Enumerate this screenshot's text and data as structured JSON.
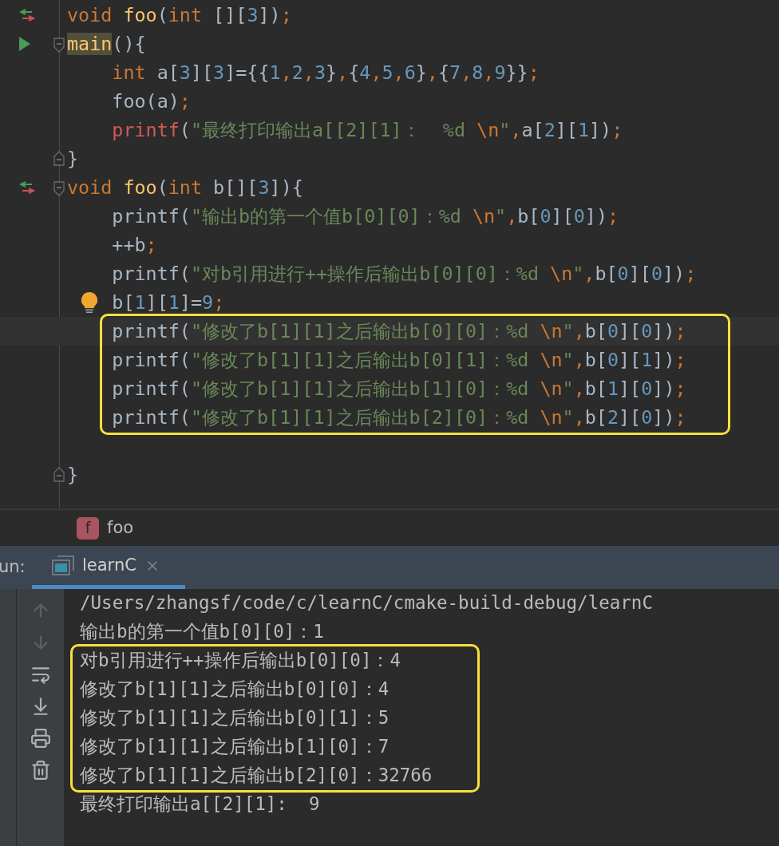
{
  "editor": {
    "lines": [
      {
        "marker": {
          "kind": "override"
        },
        "current": false,
        "boxed": false,
        "tokens": [
          {
            "kind": "kw",
            "text": "void"
          },
          {
            "kind": "fn",
            "text": " foo"
          },
          {
            "kind": "plain",
            "text": "("
          },
          {
            "kind": "kw",
            "text": "int"
          },
          {
            "kind": "plain",
            "text": " []["
          },
          {
            "kind": "num",
            "text": "3"
          },
          {
            "kind": "plain",
            "text": "])"
          },
          {
            "kind": "punct",
            "text": ";"
          }
        ]
      },
      {
        "marker": {
          "kind": "run"
        },
        "fold": {
          "kind": "start"
        },
        "current": false,
        "boxed": false,
        "tokens": [
          {
            "kind": "fn_hl",
            "text": "main"
          },
          {
            "kind": "plain",
            "text": "(){"
          }
        ]
      },
      {
        "current": false,
        "boxed": false,
        "tokens": [
          {
            "kind": "kw",
            "text": "    int"
          },
          {
            "kind": "plain",
            "text": " a["
          },
          {
            "kind": "num",
            "text": "3"
          },
          {
            "kind": "plain",
            "text": "]["
          },
          {
            "kind": "num",
            "text": "3"
          },
          {
            "kind": "plain",
            "text": "]={{"
          },
          {
            "kind": "num",
            "text": "1"
          },
          {
            "kind": "punct",
            "text": ","
          },
          {
            "kind": "num",
            "text": "2"
          },
          {
            "kind": "punct",
            "text": ","
          },
          {
            "kind": "num",
            "text": "3"
          },
          {
            "kind": "plain",
            "text": "}"
          },
          {
            "kind": "punct",
            "text": ","
          },
          {
            "kind": "plain",
            "text": "{"
          },
          {
            "kind": "num",
            "text": "4"
          },
          {
            "kind": "punct",
            "text": ","
          },
          {
            "kind": "num",
            "text": "5"
          },
          {
            "kind": "punct",
            "text": ","
          },
          {
            "kind": "num",
            "text": "6"
          },
          {
            "kind": "plain",
            "text": "}"
          },
          {
            "kind": "punct",
            "text": ","
          },
          {
            "kind": "plain",
            "text": "{"
          },
          {
            "kind": "num",
            "text": "7"
          },
          {
            "kind": "punct",
            "text": ","
          },
          {
            "kind": "num",
            "text": "8"
          },
          {
            "kind": "punct",
            "text": ","
          },
          {
            "kind": "num",
            "text": "9"
          },
          {
            "kind": "plain",
            "text": "}}"
          },
          {
            "kind": "punct",
            "text": ";"
          }
        ]
      },
      {
        "current": false,
        "boxed": false,
        "tokens": [
          {
            "kind": "plain",
            "text": "    foo(a)"
          },
          {
            "kind": "punct",
            "text": ";"
          }
        ]
      },
      {
        "current": false,
        "boxed": false,
        "tokens": [
          {
            "kind": "macro",
            "text": "    printf"
          },
          {
            "kind": "plain",
            "text": "("
          },
          {
            "kind": "str",
            "text": "\"最终打印输出a[[2][1]：  %d "
          },
          {
            "kind": "esc",
            "text": "\\n"
          },
          {
            "kind": "str",
            "text": "\""
          },
          {
            "kind": "punct",
            "text": ","
          },
          {
            "kind": "plain",
            "text": "a["
          },
          {
            "kind": "num",
            "text": "2"
          },
          {
            "kind": "plain",
            "text": "]["
          },
          {
            "kind": "num",
            "text": "1"
          },
          {
            "kind": "plain",
            "text": "])"
          },
          {
            "kind": "punct",
            "text": ";"
          }
        ]
      },
      {
        "fold": {
          "kind": "end"
        },
        "current": false,
        "boxed": false,
        "tokens": [
          {
            "kind": "plain",
            "text": "}"
          }
        ]
      },
      {
        "marker": {
          "kind": "override"
        },
        "fold": {
          "kind": "start"
        },
        "current": false,
        "boxed": false,
        "tokens": [
          {
            "kind": "kw",
            "text": "void"
          },
          {
            "kind": "fn",
            "text": " foo"
          },
          {
            "kind": "plain",
            "text": "("
          },
          {
            "kind": "kw",
            "text": "int"
          },
          {
            "kind": "plain",
            "text": " b[]["
          },
          {
            "kind": "num",
            "text": "3"
          },
          {
            "kind": "plain",
            "text": "]){"
          }
        ]
      },
      {
        "current": false,
        "boxed": false,
        "tokens": [
          {
            "kind": "plain",
            "text": "    printf("
          },
          {
            "kind": "str",
            "text": "\"输出b的第一个值b[0][0]：%d "
          },
          {
            "kind": "esc",
            "text": "\\n"
          },
          {
            "kind": "str",
            "text": "\""
          },
          {
            "kind": "punct",
            "text": ","
          },
          {
            "kind": "plain",
            "text": "b["
          },
          {
            "kind": "num",
            "text": "0"
          },
          {
            "kind": "plain",
            "text": "]["
          },
          {
            "kind": "num",
            "text": "0"
          },
          {
            "kind": "plain",
            "text": "])"
          },
          {
            "kind": "punct",
            "text": ";"
          }
        ]
      },
      {
        "current": false,
        "boxed": false,
        "tokens": [
          {
            "kind": "plain",
            "text": "    ++b"
          },
          {
            "kind": "punct",
            "text": ";"
          }
        ]
      },
      {
        "current": false,
        "boxed": false,
        "tokens": [
          {
            "kind": "plain",
            "text": "    printf("
          },
          {
            "kind": "str",
            "text": "\"对b引用进行++操作后输出b[0][0]：%d "
          },
          {
            "kind": "esc",
            "text": "\\n"
          },
          {
            "kind": "str",
            "text": "\""
          },
          {
            "kind": "punct",
            "text": ","
          },
          {
            "kind": "plain",
            "text": "b["
          },
          {
            "kind": "num",
            "text": "0"
          },
          {
            "kind": "plain",
            "text": "]["
          },
          {
            "kind": "num",
            "text": "0"
          },
          {
            "kind": "plain",
            "text": "])"
          },
          {
            "kind": "punct",
            "text": ";"
          }
        ]
      },
      {
        "marker": {
          "kind": "bulb"
        },
        "current": false,
        "boxed": false,
        "tokens": [
          {
            "kind": "plain",
            "text": "    b["
          },
          {
            "kind": "num",
            "text": "1"
          },
          {
            "kind": "plain",
            "text": "]["
          },
          {
            "kind": "num",
            "text": "1"
          },
          {
            "kind": "plain",
            "text": "]="
          },
          {
            "kind": "num",
            "text": "9"
          },
          {
            "kind": "punct",
            "text": ";"
          }
        ]
      },
      {
        "current": true,
        "boxed": true,
        "tokens": [
          {
            "kind": "plain",
            "text": "    printf("
          },
          {
            "kind": "str",
            "text": "\"修改了b[1][1]之后输出b[0][0]：%d "
          },
          {
            "kind": "esc",
            "text": "\\n"
          },
          {
            "kind": "str",
            "text": "\""
          },
          {
            "kind": "punct",
            "text": ","
          },
          {
            "kind": "plain",
            "text": "b["
          },
          {
            "kind": "num",
            "text": "0"
          },
          {
            "kind": "plain",
            "text": "]["
          },
          {
            "kind": "num",
            "text": "0"
          },
          {
            "kind": "plain",
            "text": "])"
          },
          {
            "kind": "punct",
            "text": ";"
          }
        ]
      },
      {
        "current": false,
        "boxed": true,
        "tokens": [
          {
            "kind": "plain",
            "text": "    printf("
          },
          {
            "kind": "str",
            "text": "\"修改了b[1][1]之后输出b[0][1]：%d "
          },
          {
            "kind": "esc",
            "text": "\\n"
          },
          {
            "kind": "str",
            "text": "\""
          },
          {
            "kind": "punct",
            "text": ","
          },
          {
            "kind": "plain",
            "text": "b["
          },
          {
            "kind": "num",
            "text": "0"
          },
          {
            "kind": "plain",
            "text": "]["
          },
          {
            "kind": "num",
            "text": "1"
          },
          {
            "kind": "plain",
            "text": "])"
          },
          {
            "kind": "punct",
            "text": ";"
          }
        ]
      },
      {
        "current": false,
        "boxed": true,
        "tokens": [
          {
            "kind": "plain",
            "text": "    printf("
          },
          {
            "kind": "str",
            "text": "\"修改了b[1][1]之后输出b[1][0]：%d "
          },
          {
            "kind": "esc",
            "text": "\\n"
          },
          {
            "kind": "str",
            "text": "\""
          },
          {
            "kind": "punct",
            "text": ","
          },
          {
            "kind": "plain",
            "text": "b["
          },
          {
            "kind": "num",
            "text": "1"
          },
          {
            "kind": "plain",
            "text": "]["
          },
          {
            "kind": "num",
            "text": "0"
          },
          {
            "kind": "plain",
            "text": "])"
          },
          {
            "kind": "punct",
            "text": ";"
          }
        ]
      },
      {
        "current": false,
        "boxed": true,
        "tokens": [
          {
            "kind": "plain",
            "text": "    printf("
          },
          {
            "kind": "str",
            "text": "\"修改了b[1][1]之后输出b[2][0]：%d "
          },
          {
            "kind": "esc",
            "text": "\\n"
          },
          {
            "kind": "str",
            "text": "\""
          },
          {
            "kind": "punct",
            "text": ","
          },
          {
            "kind": "plain",
            "text": "b["
          },
          {
            "kind": "num",
            "text": "2"
          },
          {
            "kind": "plain",
            "text": "]["
          },
          {
            "kind": "num",
            "text": "0"
          },
          {
            "kind": "plain",
            "text": "])"
          },
          {
            "kind": "punct",
            "text": ";"
          }
        ]
      },
      {
        "current": false
      },
      {
        "fold": {
          "kind": "end"
        },
        "current": false,
        "boxed": false,
        "tokens": [
          {
            "kind": "plain",
            "text": "}"
          }
        ]
      }
    ]
  },
  "breadcrumb": {
    "icon_letter": "f",
    "label": "foo"
  },
  "run_panel": {
    "label": "un:",
    "tabs": [
      {
        "label": "learnC",
        "selected": true
      }
    ],
    "output": [
      {
        "text": "/Users/zhangsf/code/c/learnC/cmake-build-debug/learnC",
        "boxed": false
      },
      {
        "text": "输出b的第一个值b[0][0]：1",
        "boxed": false
      },
      {
        "text": "对b引用进行++操作后输出b[0][0]：4",
        "boxed": true
      },
      {
        "text": "修改了b[1][1]之后输出b[0][0]：4",
        "boxed": true
      },
      {
        "text": "修改了b[1][1]之后输出b[0][1]：5",
        "boxed": true
      },
      {
        "text": "修改了b[1][1]之后输出b[1][0]：7",
        "boxed": true
      },
      {
        "text": "修改了b[1][1]之后输出b[2][0]：32766",
        "boxed": true
      },
      {
        "text": "最终打印输出a[[2][1]:  9",
        "boxed": false
      }
    ]
  }
}
